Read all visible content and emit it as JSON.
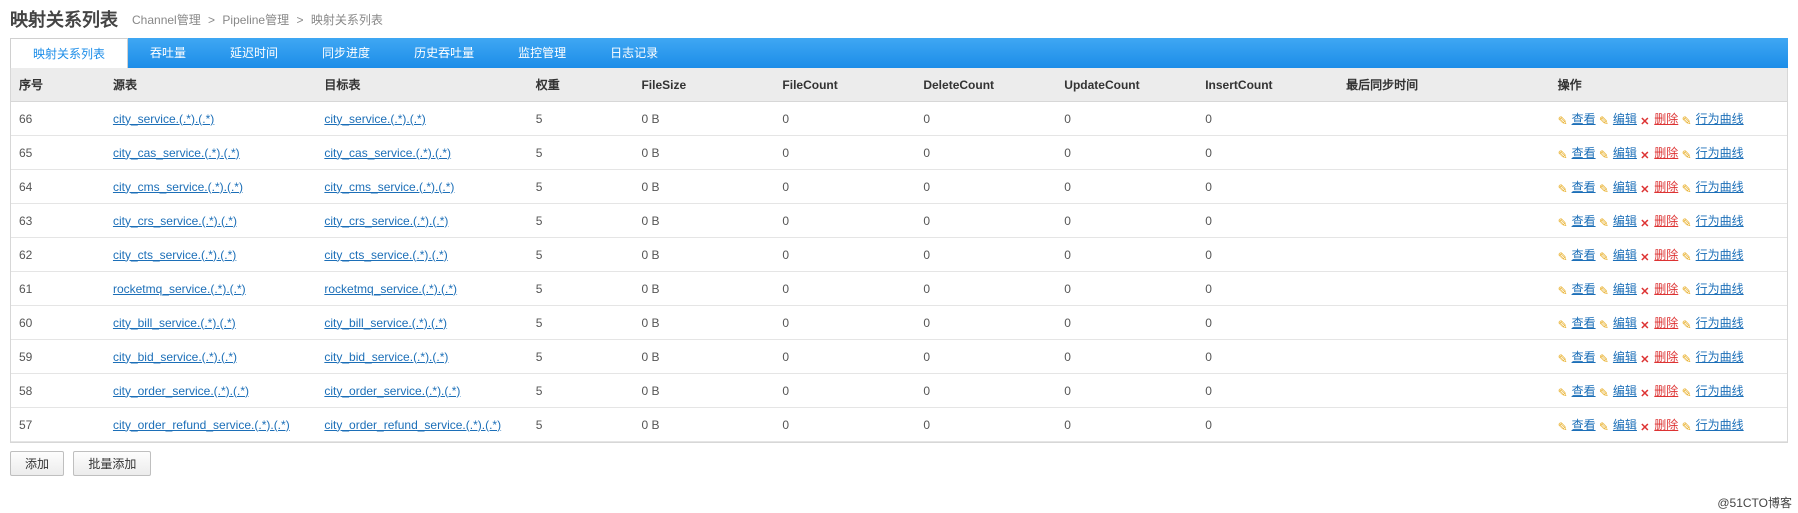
{
  "title": "映射关系列表",
  "breadcrumb": {
    "a": "Channel管理",
    "b": "Pipeline管理",
    "c": "映射关系列表",
    "sep": ">"
  },
  "tabs": [
    {
      "label": "映射关系列表",
      "active": true
    },
    {
      "label": "吞吐量"
    },
    {
      "label": "延迟时间"
    },
    {
      "label": "同步进度"
    },
    {
      "label": "历史吞吐量"
    },
    {
      "label": "监控管理"
    },
    {
      "label": "日志记录"
    }
  ],
  "columns": {
    "seq": "序号",
    "src": "源表",
    "dst": "目标表",
    "weight": "权重",
    "fileSize": "FileSize",
    "fileCount": "FileCount",
    "deleteCount": "DeleteCount",
    "updateCount": "UpdateCount",
    "insertCount": "InsertCount",
    "lastSync": "最后同步时间",
    "ops": "操作"
  },
  "ops": {
    "view": "查看",
    "edit": "编辑",
    "delete": "删除",
    "curve": "行为曲线"
  },
  "buttons": {
    "add": "添加",
    "batchAdd": "批量添加"
  },
  "watermark": "@51CTO博客",
  "rows": [
    {
      "seq": "66",
      "src": "city_service.(.*).(.*)",
      "dst": "city_service.(.*).(.*)",
      "weight": "5",
      "fileSize": "0 B",
      "fileCount": "0",
      "deleteCount": "0",
      "updateCount": "0",
      "insertCount": "0",
      "lastSync": ""
    },
    {
      "seq": "65",
      "src": "city_cas_service.(.*).(.*)",
      "dst": "city_cas_service.(.*).(.*)",
      "weight": "5",
      "fileSize": "0 B",
      "fileCount": "0",
      "deleteCount": "0",
      "updateCount": "0",
      "insertCount": "0",
      "lastSync": ""
    },
    {
      "seq": "64",
      "src": "city_cms_service.(.*).(.*)",
      "dst": "city_cms_service.(.*).(.*)",
      "weight": "5",
      "fileSize": "0 B",
      "fileCount": "0",
      "deleteCount": "0",
      "updateCount": "0",
      "insertCount": "0",
      "lastSync": ""
    },
    {
      "seq": "63",
      "src": "city_crs_service.(.*).(.*)",
      "dst": "city_crs_service.(.*).(.*)",
      "weight": "5",
      "fileSize": "0 B",
      "fileCount": "0",
      "deleteCount": "0",
      "updateCount": "0",
      "insertCount": "0",
      "lastSync": ""
    },
    {
      "seq": "62",
      "src": "city_cts_service.(.*).(.*)",
      "dst": "city_cts_service.(.*).(.*)",
      "weight": "5",
      "fileSize": "0 B",
      "fileCount": "0",
      "deleteCount": "0",
      "updateCount": "0",
      "insertCount": "0",
      "lastSync": ""
    },
    {
      "seq": "61",
      "src": "rocketmq_service.(.*).(.*)",
      "dst": "rocketmq_service.(.*).(.*)",
      "weight": "5",
      "fileSize": "0 B",
      "fileCount": "0",
      "deleteCount": "0",
      "updateCount": "0",
      "insertCount": "0",
      "lastSync": ""
    },
    {
      "seq": "60",
      "src": "city_bill_service.(.*).(.*)",
      "dst": "city_bill_service.(.*).(.*)",
      "weight": "5",
      "fileSize": "0 B",
      "fileCount": "0",
      "deleteCount": "0",
      "updateCount": "0",
      "insertCount": "0",
      "lastSync": ""
    },
    {
      "seq": "59",
      "src": "city_bid_service.(.*).(.*)",
      "dst": "city_bid_service.(.*).(.*)",
      "weight": "5",
      "fileSize": "0 B",
      "fileCount": "0",
      "deleteCount": "0",
      "updateCount": "0",
      "insertCount": "0",
      "lastSync": ""
    },
    {
      "seq": "58",
      "src": "city_order_service.(.*).(.*)",
      "dst": "city_order_service.(.*).(.*)",
      "weight": "5",
      "fileSize": "0 B",
      "fileCount": "0",
      "deleteCount": "0",
      "updateCount": "0",
      "insertCount": "0",
      "lastSync": ""
    },
    {
      "seq": "57",
      "src": "city_order_refund_service.(.*).(.*)",
      "dst": "city_order_refund_service.(.*).(.*)",
      "weight": "5",
      "fileSize": "0 B",
      "fileCount": "0",
      "deleteCount": "0",
      "updateCount": "0",
      "insertCount": "0",
      "lastSync": ""
    }
  ]
}
